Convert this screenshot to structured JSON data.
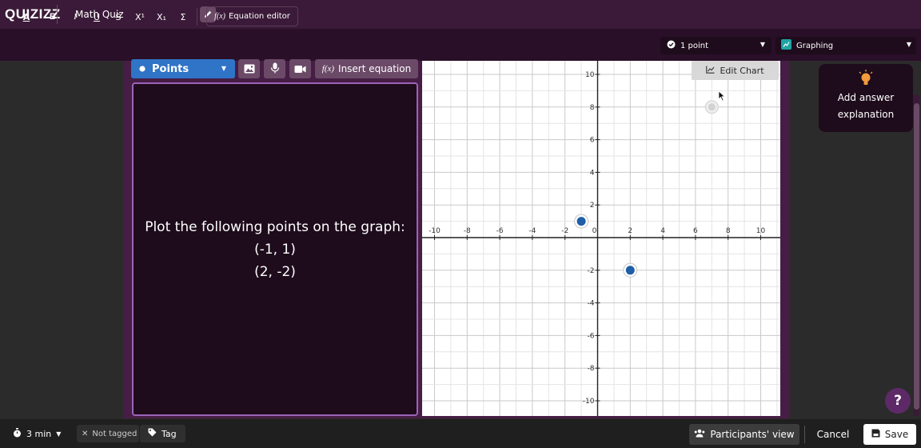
{
  "app": {
    "logo": "QUIZIZZ",
    "quiz_title": "Math Quiz"
  },
  "toolbar": {
    "text_color": "A",
    "bold": "B",
    "italic": "I",
    "underline": "U",
    "strike": "S",
    "superscript": "X¹",
    "subscript": "X₁",
    "sigma": "Σ",
    "equation_editor_icon": "f(x)",
    "equation_editor": "Equation editor",
    "points_value": "1 point",
    "question_type": "Graphing"
  },
  "editor": {
    "answer_type": "Points",
    "insert_equation_icon": "f(x)",
    "insert_equation": "Insert equation",
    "question_lines": [
      "Plot the following points on the graph:",
      "(-1, 1)",
      "(2, -2)"
    ]
  },
  "graph": {
    "edit_chart": "Edit Chart",
    "x_range": [
      -10,
      10
    ],
    "y_visible": [
      -10.5,
      11
    ],
    "tick_step": 2,
    "x_ticks": [
      -10,
      -8,
      -6,
      -4,
      -2,
      0,
      2,
      4,
      6,
      8,
      10
    ],
    "y_ticks": [
      10,
      8,
      6,
      4,
      2,
      -2,
      -4,
      -6,
      -8,
      -10
    ],
    "plotted_points": [
      {
        "x": -1,
        "y": 1
      },
      {
        "x": 2,
        "y": -2
      }
    ],
    "ghost_point": {
      "x": 7,
      "y": 8
    },
    "point_color": "#1f5ea8"
  },
  "sidebar": {
    "add_answer_explanation": "Add answer explanation"
  },
  "help": {
    "label": "?"
  },
  "footer": {
    "time": "3 min",
    "tag_status": "Not tagged",
    "tag": "Tag",
    "participants_view": "Participants' view",
    "cancel": "Cancel",
    "save": "Save"
  },
  "colors": {
    "accent_purple": "#461d45",
    "question_bg": "#1e0c1c",
    "answer_blue": "#2f74c6"
  }
}
